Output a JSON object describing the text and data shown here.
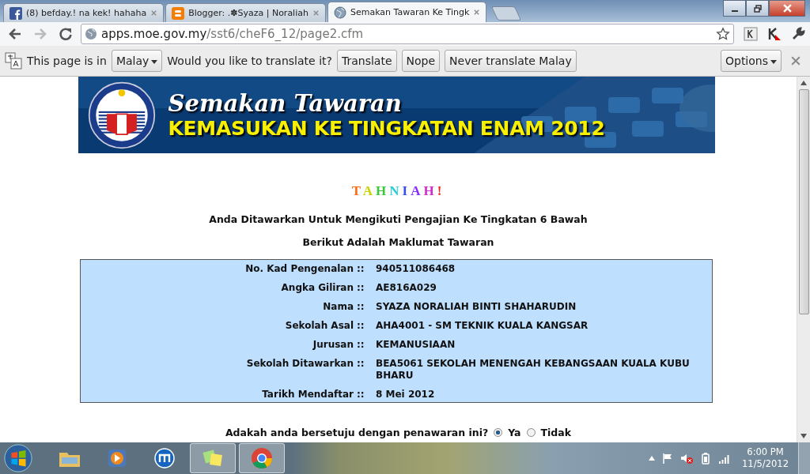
{
  "tabs": [
    {
      "title": "(8) befday.! na kek! hahaha",
      "kind": "facebook",
      "selected": false
    },
    {
      "title": "Blogger: .✽Syaza | Noraliah",
      "kind": "blogger",
      "selected": false
    },
    {
      "title": "Semakan Tawaran Ke Tingk",
      "kind": "globe",
      "selected": true
    }
  ],
  "address_bar": {
    "host": "apps.moe.gov.my",
    "path": "/sst6/cheF6_12/page2.cfm"
  },
  "translate_bar": {
    "prefix": "This page is in",
    "language": "Malay",
    "question": "Would you like to translate it?",
    "buttons": [
      "Translate",
      "Nope",
      "Never translate Malay"
    ],
    "options": "Options"
  },
  "banner": {
    "title": "Semakan Tawaran",
    "subtitle": "KEMASUKAN KE TINGKATAN ENAM 2012"
  },
  "greeting": [
    {
      "char": "T",
      "color": "#ff6a13"
    },
    {
      "char": "A",
      "color": "#c8d400"
    },
    {
      "char": "H",
      "color": "#3cc83c"
    },
    {
      "char": "N",
      "color": "#2ad0d0"
    },
    {
      "char": "I",
      "color": "#3a4cff"
    },
    {
      "char": "A",
      "color": "#8a2cff"
    },
    {
      "char": "H",
      "color": "#d02cd0"
    },
    {
      "char": "!",
      "color": "#ff1a1a"
    }
  ],
  "headline": "Anda Ditawarkan Untuk Mengikuti Pengajian Ke Tingkatan 6 Bawah",
  "subheadline": "Berikut Adalah Maklumat Tawaran",
  "details": [
    {
      "label": "No. Kad Pengenalan",
      "separator": "::",
      "value": "940511086468"
    },
    {
      "label": "Angka Giliran",
      "separator": "::",
      "value": "AE816A029"
    },
    {
      "label": "Nama",
      "separator": "::",
      "value": "SYAZA NORALIAH BINTI SHAHARUDIN"
    },
    {
      "label": "Sekolah Asal",
      "separator": "::",
      "value": "AHA4001 - SM TEKNIK KUALA KANGSAR"
    },
    {
      "label": "Jurusan",
      "separator": "::",
      "value": "KEMANUSIAAN"
    },
    {
      "label": "Sekolah Ditawarkan",
      "separator": "::",
      "value": "BEA5061 SEKOLAH MENENGAH KEBANGSAAN KUALA KUBU BHARU"
    },
    {
      "label": "Tarikh Mendaftar",
      "separator": "::",
      "value": "8 Mei 2012"
    }
  ],
  "question": {
    "text": "Adakah anda bersetuju dengan penawaran ini?",
    "options": [
      {
        "label": "Ya",
        "selected": true
      },
      {
        "label": "Tidak",
        "selected": false
      }
    ]
  },
  "taskbar": {
    "apps": [
      {
        "kind": "folder",
        "active": false
      },
      {
        "kind": "media",
        "active": false
      },
      {
        "kind": "maxthon",
        "active": false
      },
      {
        "kind": "notes",
        "active": true
      },
      {
        "kind": "chrome",
        "active": true
      }
    ],
    "time": "6:00 PM",
    "date": "11/5/2012"
  }
}
